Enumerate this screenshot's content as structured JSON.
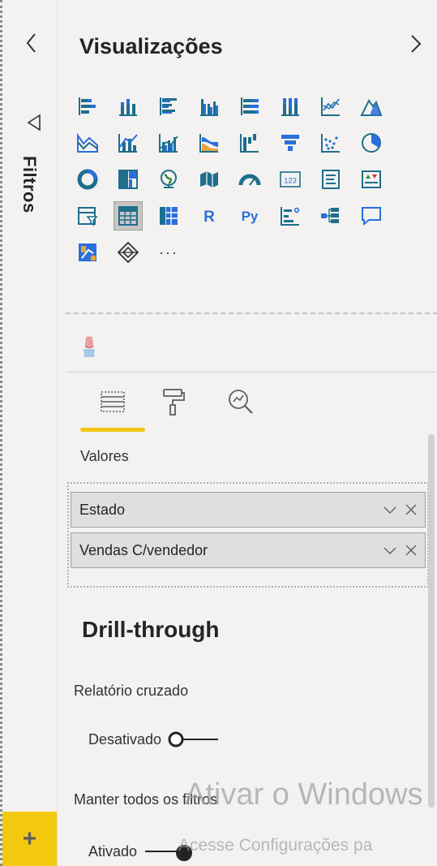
{
  "filters_pane": {
    "label": "Filtros",
    "add_symbol": "+"
  },
  "visualizations_pane": {
    "title": "Visualizações",
    "more_visuals": "···",
    "tabs": [
      {
        "name": "fields-tab",
        "icon": "fields-icon",
        "active": true
      },
      {
        "name": "format-tab",
        "icon": "paint-roller-icon",
        "active": false
      },
      {
        "name": "analytics-tab",
        "icon": "analytics-icon",
        "active": false
      }
    ],
    "values_section": {
      "label": "Valores",
      "fields": [
        "Estado",
        "Vendas C/vendedor"
      ]
    },
    "drillthrough": {
      "title": "Drill-through",
      "cross_report": {
        "label": "Relatório cruzado",
        "toggle_label": "Desativado",
        "on": false
      },
      "keep_filters": {
        "label": "Manter todos os filtros",
        "toggle_label": "Ativado",
        "on": true
      }
    }
  },
  "watermark": {
    "line1": "Ativar o Windows",
    "line2": "Acesse Configurações pa"
  },
  "colors": {
    "accent_yellow": "#f2c811",
    "pane_bg": "#f3f2f1",
    "icon_teal": "#1f6e8c",
    "icon_blue": "#2a6fdb"
  }
}
